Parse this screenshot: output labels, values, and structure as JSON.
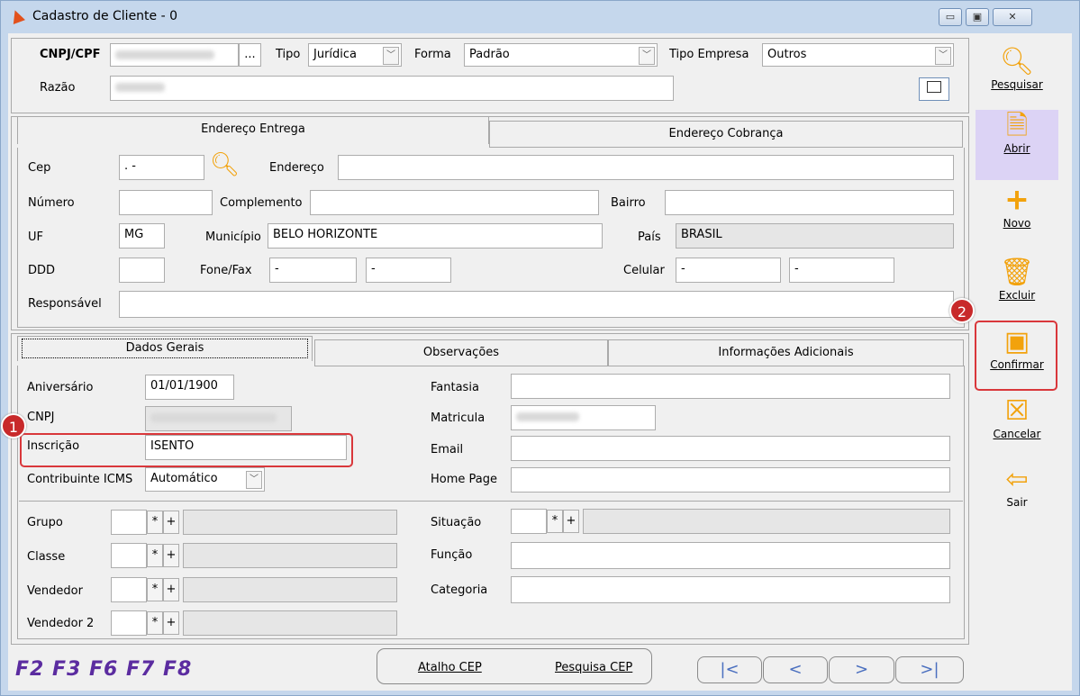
{
  "window": {
    "title": "Cadastro de Cliente - 0",
    "minimize": "▭",
    "maximize": "▣",
    "close": "✕"
  },
  "header": {
    "cnpj_label": "CNPJ/CPF",
    "cnpj_btn": "...",
    "tipo_label": "Tipo",
    "tipo_value": "Jurídica",
    "forma_label": "Forma",
    "forma_value": "Padrão",
    "tipo_empresa_label": "Tipo Empresa",
    "tipo_empresa_value": "Outros",
    "razao_label": "Razão"
  },
  "address_tabs": [
    "Endereço Entrega",
    "Endereço Cobrança"
  ],
  "address": {
    "cep_label": "Cep",
    "cep_value": " .  -",
    "endereco_label": "Endereço",
    "numero_label": "Número",
    "complemento_label": "Complemento",
    "bairro_label": "Bairro",
    "uf_label": "UF",
    "uf_value": "MG",
    "municipio_label": "Município",
    "municipio_value": "BELO HORIZONTE",
    "pais_label": "País",
    "pais_value": "BRASIL",
    "ddd_label": "DDD",
    "fone_label": "Fone/Fax",
    "fone1_value": "    -",
    "fone2_value": "    -",
    "celular_label": "Celular",
    "cel1_value": "    -",
    "cel2_value": "    -",
    "responsavel_label": "Responsável"
  },
  "detail_tabs": [
    "Dados Gerais",
    "Observações",
    "Informações Adicionais"
  ],
  "dados": {
    "aniversario_label": "Aniversário",
    "aniversario_value": "01/01/1900",
    "cnpj_label": "CNPJ",
    "inscricao_label": "Inscrição",
    "inscricao_value": "ISENTO",
    "contribuinte_label": "Contribuinte ICMS",
    "contribuinte_value": "Automático",
    "fantasia_label": "Fantasia",
    "matricula_label": "Matricula",
    "email_label": "Email",
    "homepage_label": "Home Page",
    "grupo_label": "Grupo",
    "classe_label": "Classe",
    "vendedor_label": "Vendedor",
    "vendedor2_label": "Vendedor 2",
    "situacao_label": "Situação",
    "funcao_label": "Função",
    "categoria_label": "Categoria",
    "star": "*",
    "plus": "+"
  },
  "toolbar": [
    {
      "label": "Pesquisar",
      "icon": "search-icon"
    },
    {
      "label": "Abrir",
      "icon": "open-icon"
    },
    {
      "label": "Novo",
      "icon": "new-icon"
    },
    {
      "label": "Excluir",
      "icon": "trash-icon"
    },
    {
      "label": "Confirmar",
      "icon": "confirm-icon"
    },
    {
      "label": "Cancelar",
      "icon": "cancel-icon"
    },
    {
      "label": "Sair",
      "icon": "exit-arrow-icon"
    }
  ],
  "footer": {
    "shortcuts": "F2 F3 F6 F7 F8",
    "atalho_cep": "Atalho CEP",
    "pesquisa_cep": "Pesquisa CEP",
    "nav": [
      "|<",
      "<",
      ">",
      ">|"
    ]
  },
  "badges": [
    "1",
    "2"
  ],
  "colors": {
    "accent": "#5b2ca0",
    "highlight": "#d9373b",
    "icon_orange": "#f2a20c"
  }
}
